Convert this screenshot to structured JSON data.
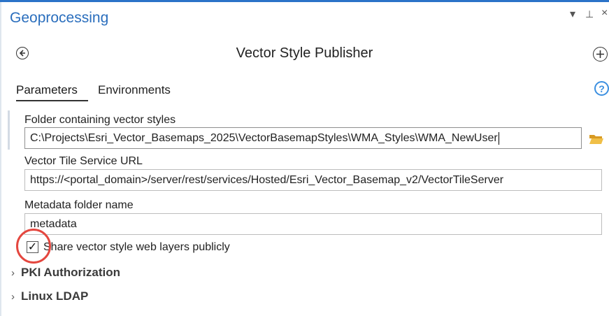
{
  "pane": {
    "title": "Geoprocessing",
    "controls": {
      "dropdown": "▾",
      "pin": "⊥",
      "close": "×"
    }
  },
  "tool": {
    "title": "Vector Style Publisher",
    "back_icon": "back-arrow-icon",
    "add_icon": "plus-icon"
  },
  "tabs": [
    {
      "label": "Parameters",
      "active": true
    },
    {
      "label": "Environments",
      "active": false
    }
  ],
  "help": {
    "glyph": "?"
  },
  "params": {
    "folder": {
      "label": "Folder containing vector styles",
      "value": "C:\\Projects\\Esri_Vector_Basemaps_2025\\VectorBasemapStyles\\WMA_Styles\\WMA_NewUser"
    },
    "service": {
      "label": "Vector Tile Service URL",
      "value": "https://<portal_domain>/server/rest/services/Hosted/Esri_Vector_Basemap_v2/VectorTileServer"
    },
    "metadata": {
      "label": "Metadata folder name",
      "value": "metadata"
    },
    "share": {
      "label": "Share vector style web layers publicly",
      "checked": true,
      "check_glyph": "✓"
    }
  },
  "groups": [
    {
      "label": "PKI Authorization",
      "chevron": "›"
    },
    {
      "label": "Linux LDAP",
      "chevron": "›"
    }
  ],
  "colors": {
    "accent": "#2a6ebd",
    "highlight_circle": "#e4473f",
    "folder": "#e9b43a"
  }
}
